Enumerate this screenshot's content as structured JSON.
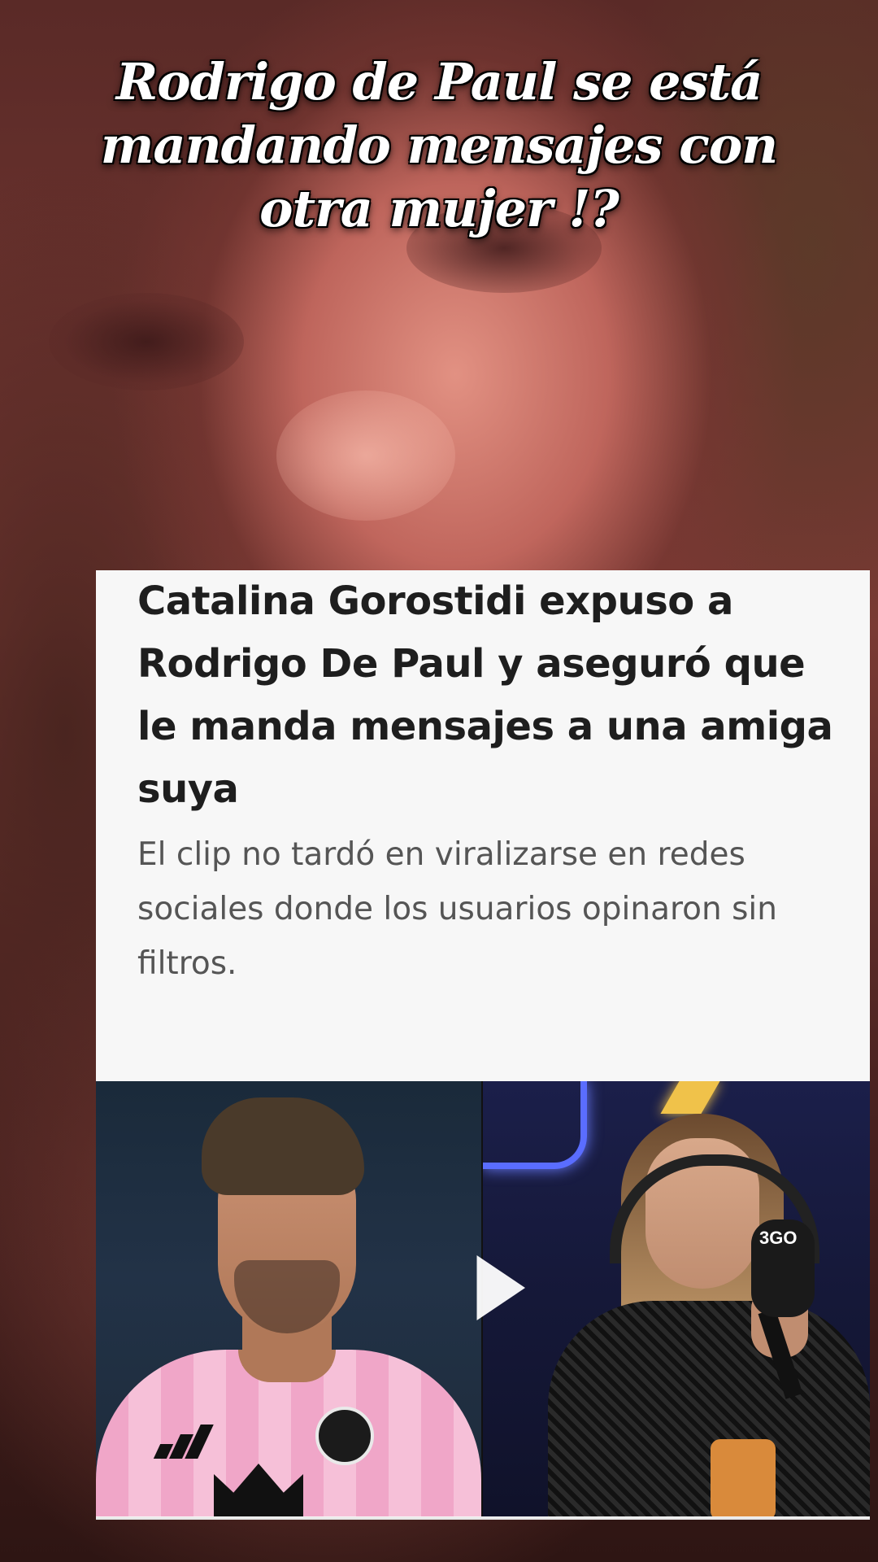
{
  "overlay": {
    "headline": "Rodrigo de Paul se está mandando mensajes con otra mujer !?"
  },
  "article": {
    "title": "Catalina Gorostidi expuso a Rodrigo De Paul y aseguró que le manda mensajes a una amiga suya",
    "subtitle": "El clip no tardó en viralizarse en redes sociales donde los usuarios opinaron sin filtros."
  },
  "media": {
    "mic_brand": "3GO",
    "play_icon": "play-icon"
  },
  "colors": {
    "card_background": "#f7f7f7",
    "title_color": "#1e1e1e",
    "subtitle_color": "#555555",
    "jersey_pink": "#f0a6c8",
    "neon_blue": "#5a6dff"
  }
}
